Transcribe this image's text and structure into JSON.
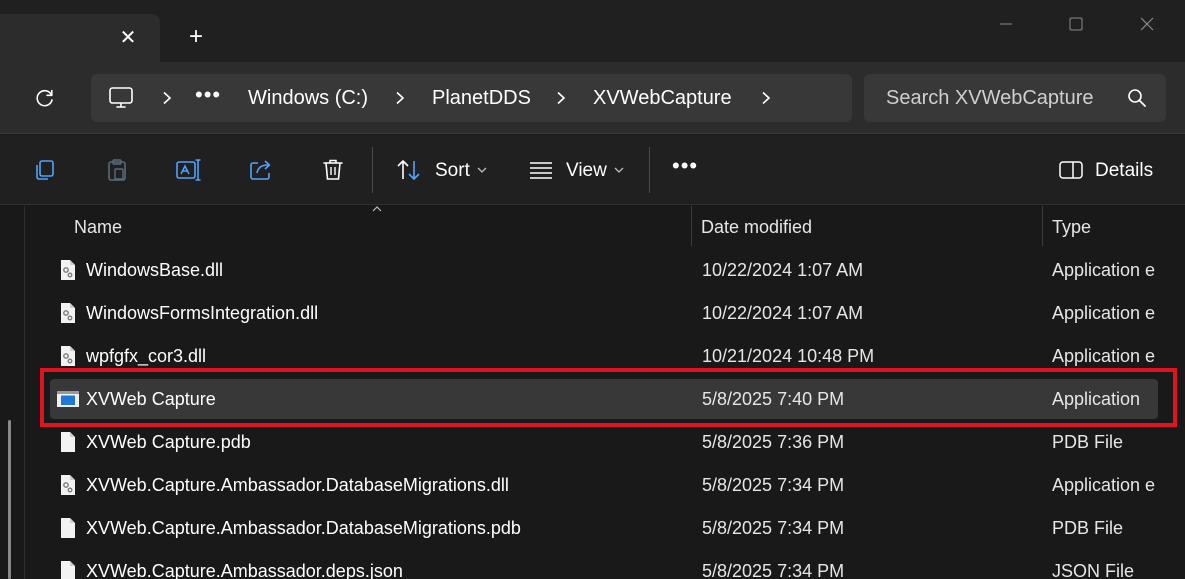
{
  "window": {
    "tab_close_glyph": "✕",
    "new_tab_glyph": "+"
  },
  "address": {
    "overflow_dots": "•••",
    "crumbs": [
      "Windows (C:)",
      "PlanetDDS",
      "XVWebCapture"
    ]
  },
  "search": {
    "placeholder": "Search XVWebCapture"
  },
  "commandbar": {
    "sort_label": "Sort",
    "view_label": "View",
    "more_glyph": "•••",
    "details_label": "Details"
  },
  "columns": {
    "name": "Name",
    "date": "Date modified",
    "type": "Type"
  },
  "files": [
    {
      "name": "WindowsBase.dll",
      "date": "10/22/2024 1:07 AM",
      "type": "Application e",
      "icon": "dll-file-icon"
    },
    {
      "name": "WindowsFormsIntegration.dll",
      "date": "10/22/2024 1:07 AM",
      "type": "Application e",
      "icon": "dll-file-icon"
    },
    {
      "name": "wpfgfx_cor3.dll",
      "date": "10/21/2024 10:48 PM",
      "type": "Application e",
      "icon": "dll-file-icon"
    },
    {
      "name": "XVWeb Capture",
      "date": "5/8/2025 7:40 PM",
      "type": "Application",
      "icon": "application-icon",
      "selected": true
    },
    {
      "name": "XVWeb Capture.pdb",
      "date": "5/8/2025 7:36 PM",
      "type": "PDB File",
      "icon": "blank-file-icon"
    },
    {
      "name": "XVWeb.Capture.Ambassador.DatabaseMigrations.dll",
      "date": "5/8/2025 7:34 PM",
      "type": "Application e",
      "icon": "dll-file-icon"
    },
    {
      "name": "XVWeb.Capture.Ambassador.DatabaseMigrations.pdb",
      "date": "5/8/2025 7:34 PM",
      "type": "PDB File",
      "icon": "blank-file-icon"
    },
    {
      "name": "XVWeb.Capture.Ambassador.deps.json",
      "date": "5/8/2025 7:34 PM",
      "type": "JSON File",
      "icon": "blank-file-icon"
    }
  ],
  "colors": {
    "highlight": "#e0141e",
    "selected_row": "#383838",
    "accent_blue": "#1e78d7"
  }
}
